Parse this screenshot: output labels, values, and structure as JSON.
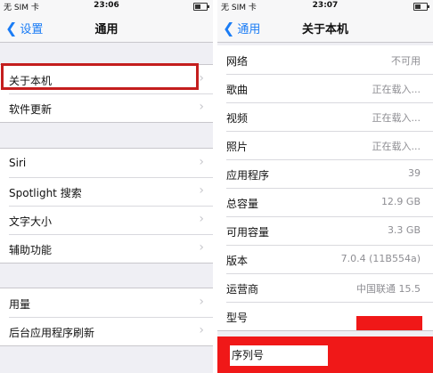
{
  "left": {
    "status": {
      "carrier": "无 SIM 卡 ",
      "time": "23:06",
      "battery_level": 0.5
    },
    "nav": {
      "back_label": "设置",
      "title": "通用"
    },
    "groups": [
      {
        "rows": [
          {
            "label": "关于本机"
          },
          {
            "label": "软件更新"
          }
        ]
      },
      {
        "rows": [
          {
            "label": "Siri"
          },
          {
            "label": "Spotlight 搜索"
          },
          {
            "label": "文字大小"
          },
          {
            "label": "辅助功能"
          }
        ]
      },
      {
        "rows": [
          {
            "label": "用量"
          },
          {
            "label": "后台应用程序刷新"
          }
        ]
      }
    ]
  },
  "right": {
    "status": {
      "carrier": "无 SIM 卡 ",
      "time": "23:07",
      "battery_level": 0.5
    },
    "nav": {
      "back_label": "通用",
      "title": "关于本机"
    },
    "rows": [
      {
        "label": "网络",
        "value": "不可用"
      },
      {
        "label": "歌曲",
        "value": "正在载入..."
      },
      {
        "label": "视频",
        "value": "正在载入..."
      },
      {
        "label": "照片",
        "value": "正在载入..."
      },
      {
        "label": "应用程序",
        "value": "39"
      },
      {
        "label": "总容量",
        "value": "12.9 GB"
      },
      {
        "label": "可用容量",
        "value": "3.3 GB"
      },
      {
        "label": "版本",
        "value": "7.0.4 (11B554a)"
      },
      {
        "label": "运营商",
        "value": "中国联通 15.5"
      },
      {
        "label": "型号",
        "value": ""
      }
    ],
    "serial_label": "序列号"
  },
  "colors": {
    "accent": "#1a7cf5",
    "highlight": "#c41e1e",
    "redaction": "#f01818"
  }
}
